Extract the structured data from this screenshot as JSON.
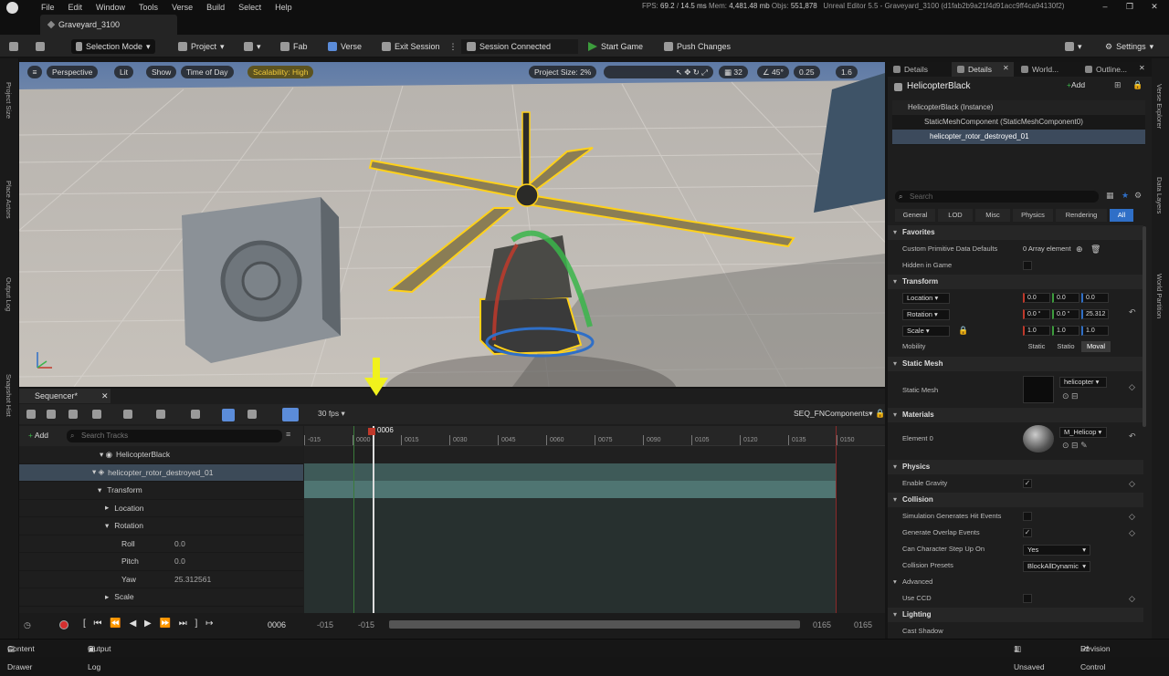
{
  "menubar": {
    "items": [
      "File",
      "Edit",
      "Window",
      "Tools",
      "Verse",
      "Build",
      "Select",
      "Help"
    ],
    "fps_label": "FPS:",
    "fps": "69.2",
    "ms": "14.5 ms",
    "mem_label": "Mem:",
    "mem": "4,481.48 mb",
    "objs_label": "Objs:",
    "objs": "551,878",
    "app_title": "Unreal Editor 5.5 - Graveyard_3100",
    "build_hash": "(d1fab2b9a21f4d91acc9ff4ca94130f2)"
  },
  "level_tab": "Graveyard_3100",
  "toolbar": {
    "selection_mode": "Selection Mode",
    "project": "Project",
    "fab": "Fab",
    "verse": "Verse",
    "exit_session": "Exit Session",
    "session_status": "Session Connected",
    "start_game": "Start Game",
    "push_changes": "Push Changes",
    "settings": "Settings"
  },
  "left_strip": [
    "Project Size",
    "Place Actors",
    "Output Log",
    "Snapshot Hist"
  ],
  "right_strip": [
    "Verse Explorer",
    "Data Layers",
    "World Partition"
  ],
  "viewport": {
    "perspective": "Perspective",
    "lit": "Lit",
    "show": "Show",
    "time_of_day": "Time of Day",
    "scalability": "Scalability: High",
    "project_size": "Project Size: 2%",
    "grid_size": "32",
    "angle": "45°",
    "scale": "0.25",
    "camera_speed": "1.6"
  },
  "sequencer": {
    "tab": "Sequencer",
    "add": "Add",
    "search_placeholder": "Search Tracks",
    "fps": "30 fps",
    "sequence_name": "SEQ_FNComponents",
    "playhead": "0006",
    "current_frame": "0006",
    "range_start": "-015",
    "range_start2": "-015",
    "range_end": "0165",
    "range_end2": "0165",
    "ruler_ticks": [
      "-015",
      "0000",
      "0015",
      "0030",
      "0045",
      "0060",
      "0075",
      "0090",
      "0105",
      "0120",
      "0135",
      "0150"
    ],
    "tracks": [
      {
        "label": "HelicopterBlack",
        "value": ""
      },
      {
        "label": "helicopter_rotor_destroyed_01",
        "value": ""
      },
      {
        "label": "Transform",
        "value": ""
      },
      {
        "label": "Location",
        "value": ""
      },
      {
        "label": "Rotation",
        "value": ""
      },
      {
        "label": "Roll",
        "value": "0.0"
      },
      {
        "label": "Pitch",
        "value": "0.0"
      },
      {
        "label": "Yaw",
        "value": "25.312561"
      },
      {
        "label": "Scale",
        "value": ""
      }
    ]
  },
  "details": {
    "tabs": [
      "Details",
      "Details",
      "World...",
      "Outline..."
    ],
    "actor_name": "HelicopterBlack",
    "add": "Add",
    "hierarchy": [
      "HelicopterBlack (Instance)",
      "StaticMeshComponent (StaticMeshComponent0)",
      "helicopter_rotor_destroyed_01"
    ],
    "search_placeholder": "Search",
    "filters": [
      "General",
      "LOD",
      "Misc",
      "Physics",
      "Rendering",
      "All"
    ],
    "favorites": {
      "title": "Favorites",
      "custom_data": "Custom Primitive Data Defaults",
      "custom_data_value": "0 Array element",
      "hidden_in_game": "Hidden in Game"
    },
    "transform": {
      "title": "Transform",
      "location_label": "Location",
      "location": [
        "0.0",
        "0.0",
        "0.0"
      ],
      "rotation_label": "Rotation",
      "rotation": [
        "0.0 °",
        "0.0 °",
        "25.312"
      ],
      "scale_label": "Scale",
      "scale": [
        "1.0",
        "1.0",
        "1.0"
      ],
      "mobility_label": "Mobility",
      "mobility_options": [
        "Static",
        "Statio",
        "Moval"
      ]
    },
    "static_mesh": {
      "title": "Static Mesh",
      "label": "Static Mesh",
      "asset": "helicopter"
    },
    "materials": {
      "title": "Materials",
      "label": "Element 0",
      "asset": "M_Helicop"
    },
    "physics": {
      "title": "Physics",
      "enable_gravity": "Enable Gravity"
    },
    "collision": {
      "title": "Collision",
      "sim_hit": "Simulation Generates Hit Events",
      "overlap": "Generate Overlap Events",
      "step_up": "Can Character Step Up On",
      "step_up_value": "Yes",
      "presets": "Collision Presets",
      "presets_value": "BlockAllDynamic",
      "advanced": "Advanced",
      "use_ccd": "Use CCD"
    },
    "lighting": {
      "title": "Lighting",
      "cast_shadow": "Cast Shadow"
    }
  },
  "statusbar": {
    "content_drawer": "Content Drawer",
    "output_log": "Output Log",
    "unsaved": "1 Unsaved",
    "revision_control": "Revision Control"
  }
}
